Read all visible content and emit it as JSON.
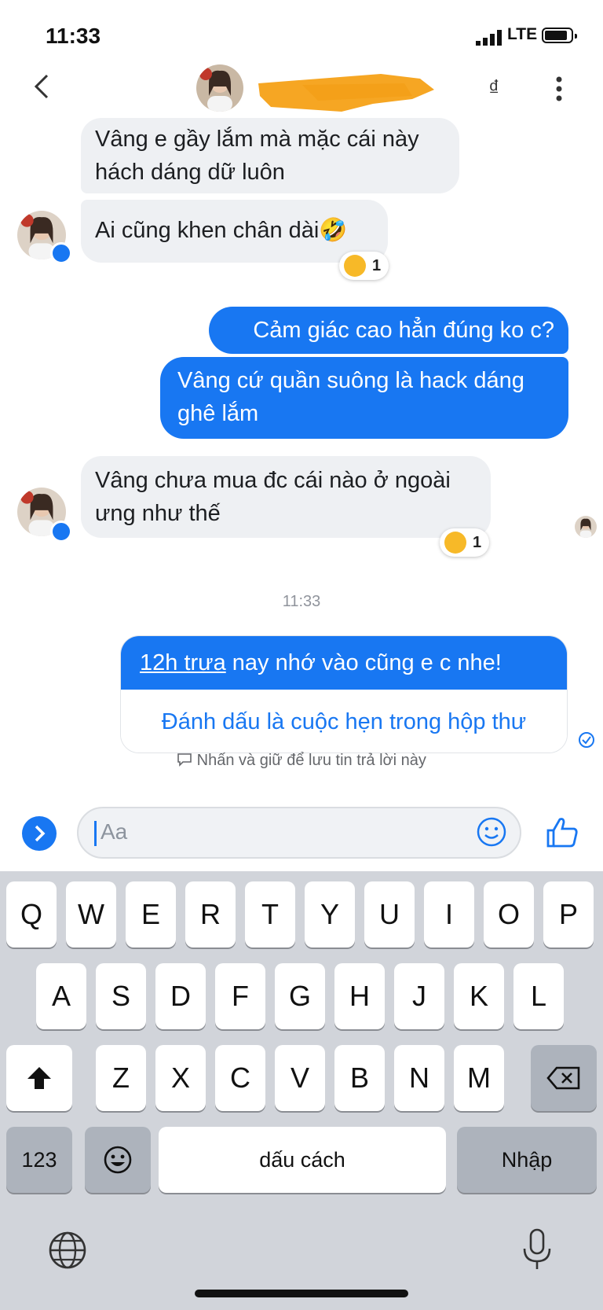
{
  "status_bar": {
    "time": "11:33",
    "network": "LTE"
  },
  "header": {
    "currency_symbol": "₫",
    "back_icon": "chevron-left-icon",
    "more_icon": "more-vertical-icon"
  },
  "messages": [
    {
      "side": "received",
      "text_lines": [
        "Vâng e gầy lắm mà mặc cái này",
        "hách dáng dữ luôn"
      ]
    },
    {
      "side": "received",
      "text_lines": [
        "Ai cũng khen chân dài🤣"
      ],
      "reaction": {
        "emoji": "😍",
        "count": "1"
      }
    },
    {
      "side": "sent",
      "text_lines": [
        "Cảm giác cao hẳn đúng ko c?"
      ]
    },
    {
      "side": "sent",
      "text_lines": [
        "Vâng cứ quần suông là hack dáng",
        "ghê lắm"
      ]
    },
    {
      "side": "received",
      "text_lines": [
        "Vâng chưa mua đc cái nào ở ngoài",
        "ưng như thế"
      ],
      "reaction": {
        "emoji": "😍",
        "count": "1"
      }
    }
  ],
  "timestamp": "11:33",
  "link_message": {
    "linked_text": "12h trưa",
    "rest_text": " nay nhớ vào cũng e c nhe!",
    "action_label": "Đánh dấu là cuộc hẹn trong hộp thư"
  },
  "hint": "Nhấn và giữ để lưu tin trả lời này",
  "composer": {
    "placeholder": "Aa"
  },
  "keyboard": {
    "row1": [
      "Q",
      "W",
      "E",
      "R",
      "T",
      "Y",
      "U",
      "I",
      "O",
      "P"
    ],
    "row2": [
      "A",
      "S",
      "D",
      "F",
      "G",
      "H",
      "J",
      "K",
      "L"
    ],
    "row3": [
      "Z",
      "X",
      "C",
      "V",
      "B",
      "N",
      "M"
    ],
    "numbers_key": "123",
    "space_key": "dấu cách",
    "return_key": "Nhập"
  },
  "colors": {
    "accent": "#1877f2",
    "received_bubble": "#eef0f3",
    "keyboard_bg": "#d1d4da"
  }
}
